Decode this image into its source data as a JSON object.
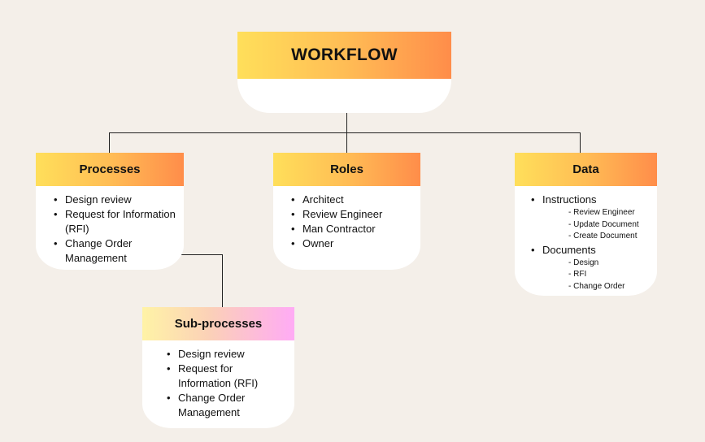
{
  "root": {
    "title": "WORKFLOW"
  },
  "processes": {
    "title": "Processes",
    "items": [
      "Design review",
      "Request for Information (RFI)",
      "Change Order Management"
    ]
  },
  "roles": {
    "title": "Roles",
    "items": [
      "Architect",
      "Review Engineer",
      "Man Contractor",
      "Owner"
    ]
  },
  "data": {
    "title": "Data",
    "groups": [
      {
        "label": "Instructions",
        "children": [
          "- Review Engineer",
          "- Update Document",
          "- Create Document"
        ]
      },
      {
        "label": "Documents",
        "children": [
          "- Design",
          "- RFI",
          "- Change Order"
        ]
      }
    ]
  },
  "subprocesses": {
    "title": "Sub-processes",
    "items": [
      "Design review",
      "Request for Information (RFI)",
      "Change Order Management"
    ]
  },
  "colors": {
    "background": "#f4efe9",
    "header_gradient": [
      "#ffdf5a",
      "#ffbd55",
      "#ff8d4a"
    ],
    "subprocess_gradient": [
      "#fff3a6",
      "#fbd0b8",
      "#ffabf5"
    ],
    "connector": "#222222"
  }
}
